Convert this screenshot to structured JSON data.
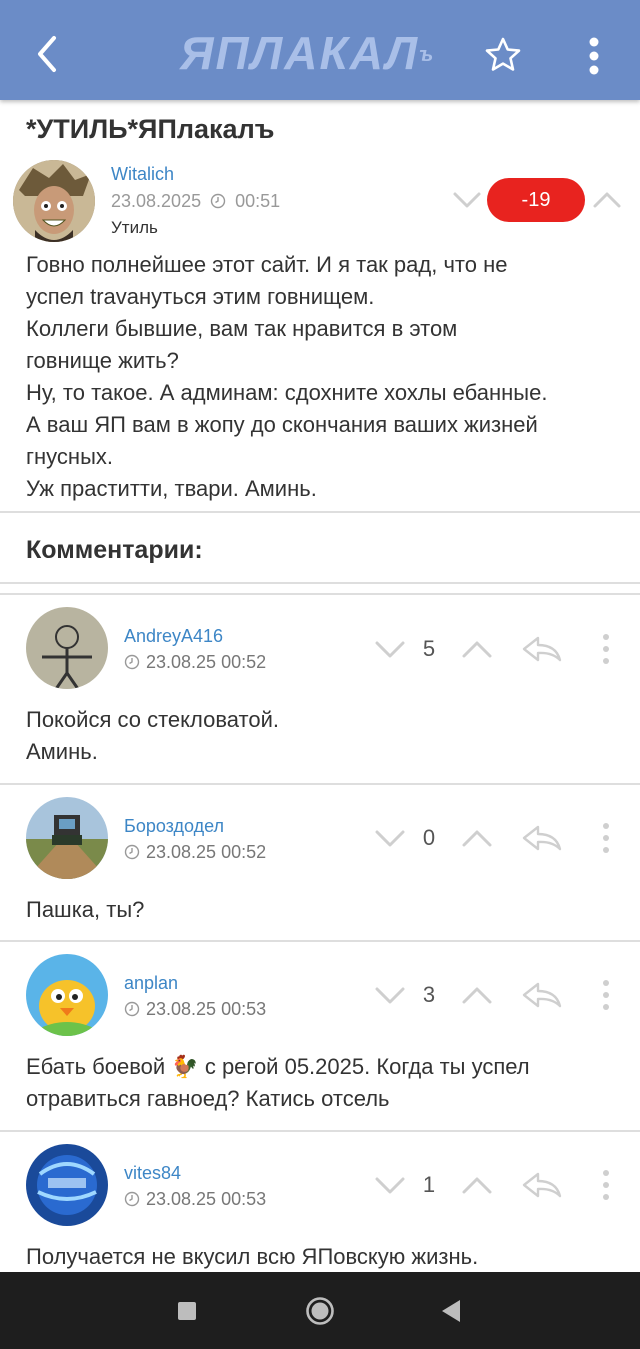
{
  "app": {
    "logo_text": "ЯПЛАКАЛ",
    "logo_sup": "ъ",
    "brand_color": "#6b8cc7"
  },
  "post": {
    "title": "*УТИЛЬ*ЯПлакалъ",
    "author": "Witalich",
    "date": "23.08.2025",
    "time": "00:51",
    "section": "Утиль",
    "rating": "-19",
    "body": [
      "Говно полнейшее этот сайт. И я так рад, что не",
      "успел travануться этим говнищем.",
      "Коллеги бывшие, вам так нравится в этом",
      "говнище жить?",
      "Ну, то такое. А админам: сдохните хохлы ебанные.",
      "А ваш ЯП вам в жопу до скончания ваших жизней",
      "гнусных.",
      "Уж праститти, твари. Аминь."
    ]
  },
  "comments_header": "Комментарии:",
  "comments": [
    {
      "author": "AndreyA416",
      "date": "23.08.25 00:52",
      "score": "5",
      "text": [
        "Покойся со стекловатой.",
        "Аминь."
      ]
    },
    {
      "author": "Бороздодел",
      "date": "23.08.25 00:52",
      "score": "0",
      "text": [
        "Пашка, ты?"
      ]
    },
    {
      "author": "anplan",
      "date": "23.08.25 00:53",
      "score": "3",
      "text": [
        "Ебать боевой 🐓 с регой 05.2025. Когда ты успел",
        "отравиться гавноед? Катись отсель"
      ]
    },
    {
      "author": "vites84",
      "date": "23.08.25 00:53",
      "score": "1",
      "text": [
        "Получается не вкусил всю ЯПовскую жизнь."
      ]
    }
  ],
  "icons": {
    "back": "back-arrow-icon",
    "favorite": "star-icon",
    "menu": "kebab-menu-icon",
    "vote_down": "chevron-down-icon",
    "vote_up": "chevron-up-icon",
    "reply": "reply-icon",
    "clock": "clock-icon"
  }
}
